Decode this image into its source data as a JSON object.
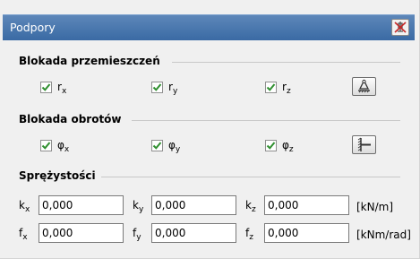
{
  "window": {
    "title": "Podpory"
  },
  "groups": {
    "displacement": {
      "heading": "Blokada przemieszczeń",
      "items": [
        {
          "symbol": "r",
          "sub": "x",
          "checked": true
        },
        {
          "symbol": "r",
          "sub": "y",
          "checked": true
        },
        {
          "symbol": "r",
          "sub": "z",
          "checked": true
        }
      ]
    },
    "rotation": {
      "heading": "Blokada obrotów",
      "items": [
        {
          "symbol": "φ",
          "sub": "x",
          "checked": true
        },
        {
          "symbol": "φ",
          "sub": "y",
          "checked": true
        },
        {
          "symbol": "φ",
          "sub": "z",
          "checked": true
        }
      ]
    },
    "elasticity": {
      "heading": "Sprężystości",
      "rows": [
        {
          "fields": [
            {
              "symbol": "k",
              "sub": "x",
              "value": "0,000"
            },
            {
              "symbol": "k",
              "sub": "y",
              "value": "0,000"
            },
            {
              "symbol": "k",
              "sub": "z",
              "value": "0,000"
            }
          ],
          "unit": "[kN/m]"
        },
        {
          "fields": [
            {
              "symbol": "f",
              "sub": "x",
              "value": "0,000"
            },
            {
              "symbol": "f",
              "sub": "y",
              "value": "0,000"
            },
            {
              "symbol": "f",
              "sub": "z",
              "value": "0,000"
            }
          ],
          "unit": "[kNm/rad]"
        }
      ]
    }
  },
  "icons": {
    "pin": "pin-off-icon",
    "support": "fixed-support-icon",
    "rotation_lock": "clamp-support-icon"
  },
  "colors": {
    "titlebar": "#4a78b0",
    "check": "#2f8f2f"
  }
}
